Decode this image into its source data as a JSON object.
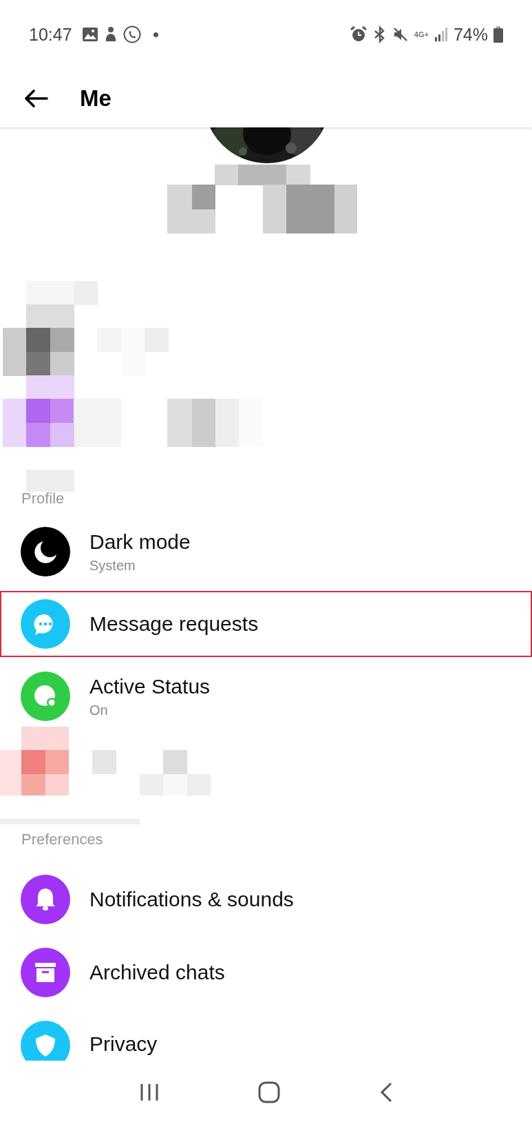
{
  "status_bar": {
    "time": "10:47",
    "network": "4G+",
    "battery": "74%"
  },
  "app_bar": {
    "title": "Me"
  },
  "sections": [
    {
      "header": "Profile",
      "items": [
        {
          "label": "Dark mode",
          "subtitle": "System",
          "color": "#000000",
          "highlighted": false
        },
        {
          "label": "Message requests",
          "color": "#1ac4f7",
          "highlighted": true
        },
        {
          "label": "Active Status",
          "subtitle": "On",
          "color": "#31cc46",
          "highlighted": false
        }
      ]
    },
    {
      "header": "Preferences",
      "items": [
        {
          "label": "Notifications & sounds",
          "color": "#a033f5",
          "highlighted": false
        },
        {
          "label": "Archived chats",
          "color": "#a033f5",
          "highlighted": false
        },
        {
          "label": "Privacy",
          "color": "#1ac4f7",
          "highlighted": false
        }
      ]
    }
  ]
}
